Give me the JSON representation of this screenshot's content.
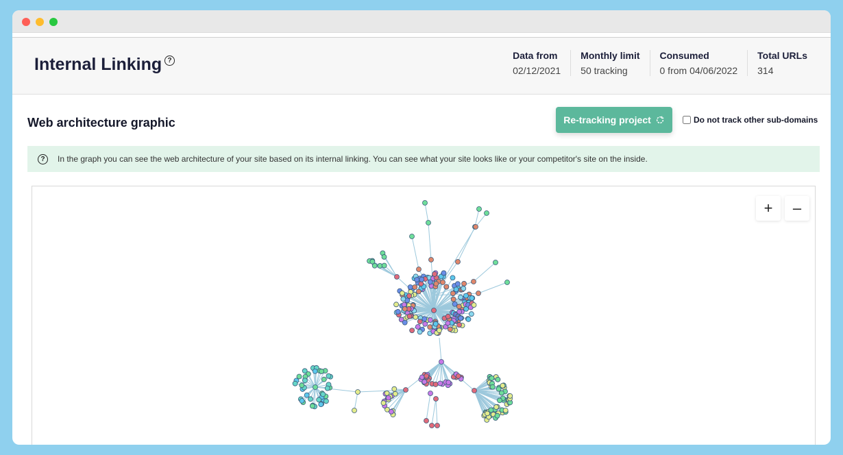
{
  "window": {
    "controls": [
      "close",
      "minimize",
      "maximize"
    ]
  },
  "header": {
    "title": "Internal Linking",
    "help_icon": "question-circle-icon",
    "stats": [
      {
        "label": "Data from",
        "value": "02/12/2021"
      },
      {
        "label": "Monthly limit",
        "value": "50 tracking"
      },
      {
        "label": "Consumed",
        "value": "0 from 04/06/2022"
      },
      {
        "label": "Total URLs",
        "value": "314"
      }
    ]
  },
  "section": {
    "title": "Web architecture graphic",
    "retrack_button": "Re-tracking project",
    "retrack_icon": "refresh-icon",
    "checkbox_label": "Do not track other sub-domains",
    "checkbox_checked": false,
    "info_icon": "question-circle-icon",
    "info_text": "In the graph you can see the web architecture of your site based on its internal linking. You can see what your site looks like or your competitor's site on the inside."
  },
  "graph": {
    "zoom_in_label": "+",
    "zoom_out_label": "–",
    "colors": {
      "edge": "#9cc8dc",
      "palette": [
        "#6a8ee8",
        "#5ec8ec",
        "#e0876b",
        "#c879e6",
        "#e4ec8c",
        "#66d6c8",
        "#e06a7a",
        "#6fde9a",
        "#9a6de0",
        "#8ad8ee"
      ],
      "node_stroke": "#3a5a7a"
    },
    "clusters": [
      {
        "id": "main",
        "node_count": 180,
        "palette_idx": [
          0,
          1,
          2,
          3,
          4,
          6,
          9
        ]
      },
      {
        "id": "pink",
        "node_count": 30,
        "palette_idx": [
          6,
          3
        ]
      },
      {
        "id": "cyan",
        "node_count": 40,
        "palette_idx": [
          5,
          1,
          7
        ]
      },
      {
        "id": "purple",
        "node_count": 18,
        "palette_idx": [
          3,
          4
        ]
      },
      {
        "id": "green",
        "node_count": 55,
        "palette_idx": [
          7,
          4
        ]
      },
      {
        "id": "small-green",
        "node_count": 8,
        "palette_idx": [
          7
        ]
      }
    ]
  }
}
